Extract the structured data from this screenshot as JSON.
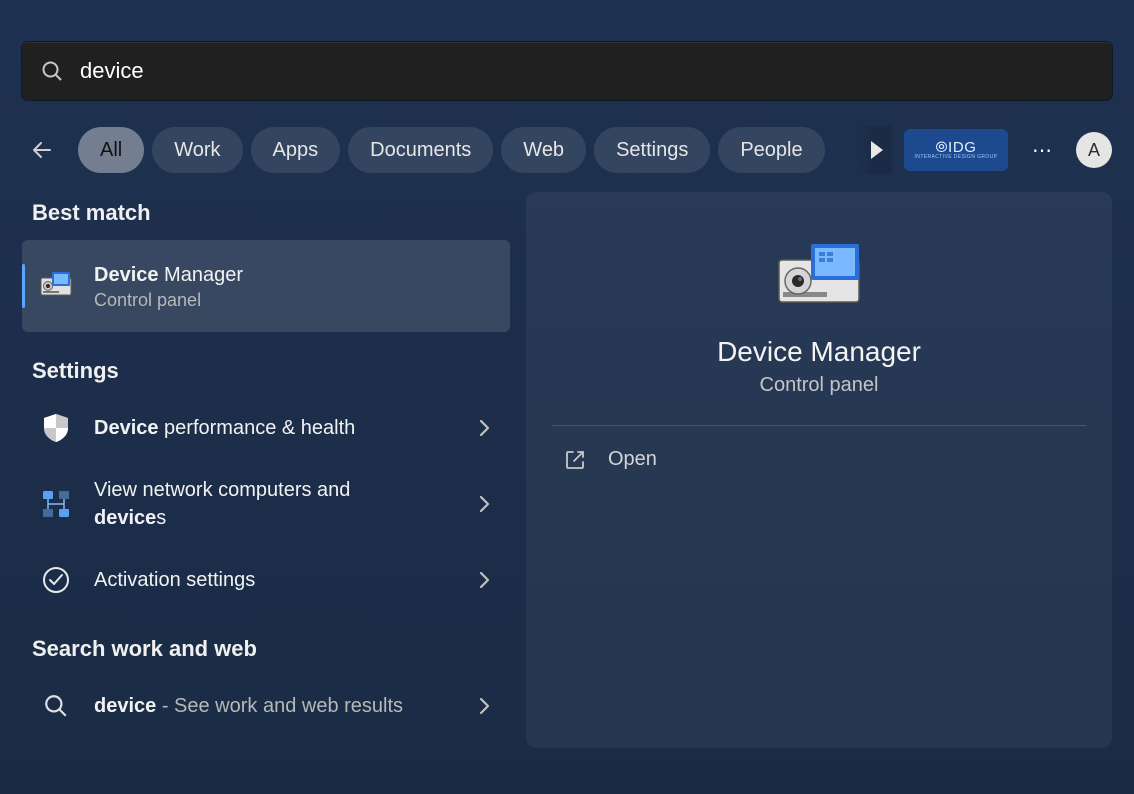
{
  "search": {
    "query": "device"
  },
  "filters": {
    "items": [
      "All",
      "Work",
      "Apps",
      "Documents",
      "Web",
      "Settings",
      "People"
    ],
    "active_index": 0
  },
  "header_tools": {
    "badge_top": "⦾IDG",
    "badge_bottom": "INTERACTIVE DESIGN GROUP",
    "more": "⋯",
    "avatar_initial": "A"
  },
  "sections": {
    "best_match": "Best match",
    "settings": "Settings",
    "search_web": "Search work and web"
  },
  "best_match_item": {
    "title_bold": "Device",
    "title_rest": " Manager",
    "subtitle": "Control panel"
  },
  "settings_items": [
    {
      "icon": "shield",
      "line1_bold": "Device",
      "line1_rest": " performance & health"
    },
    {
      "icon": "network",
      "line1": "View network computers and ",
      "line2_bold": "device",
      "line2_rest": "s"
    },
    {
      "icon": "check-circle",
      "line1": "Activation settings"
    }
  ],
  "web_item": {
    "query_bold": "device",
    "rest": " - See work and web results"
  },
  "detail": {
    "title": "Device Manager",
    "subtitle": "Control panel",
    "open_label": "Open"
  }
}
